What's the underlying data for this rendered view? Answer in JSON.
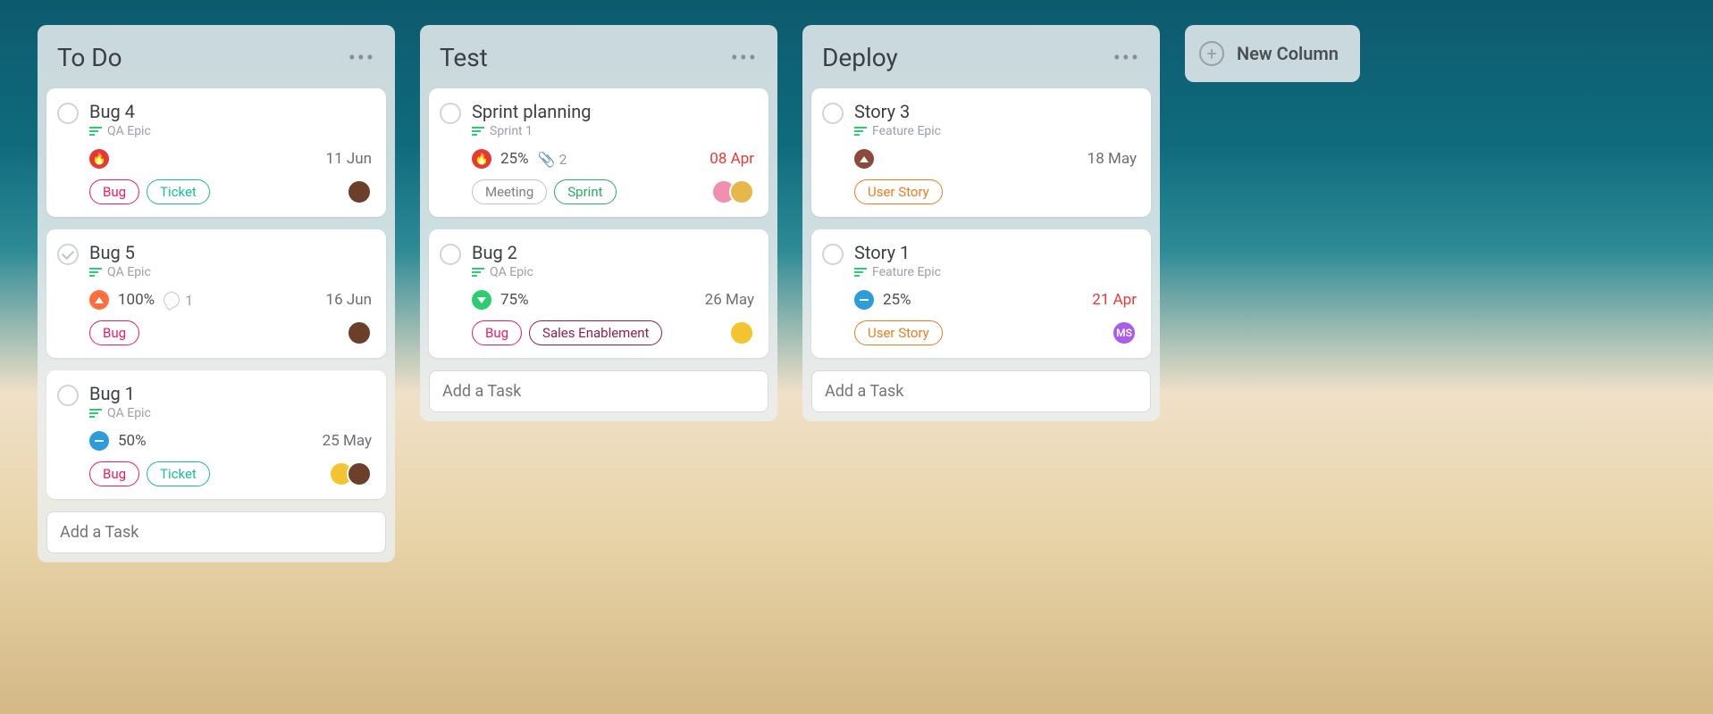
{
  "new_column_label": "New Column",
  "add_task_placeholder": "Add a Task",
  "columns": [
    {
      "title": "To Do",
      "cards": [
        {
          "title": "Bug 4",
          "epic": "QA Epic",
          "priority": "fire",
          "due": "11 Jun",
          "due_red": false,
          "tags": [
            [
              "Bug",
              "bug"
            ],
            [
              "Ticket",
              "ticket"
            ]
          ],
          "avatars": [
            {
              "bg": "#6b3f2a",
              "txt": ""
            }
          ]
        },
        {
          "title": "Bug 5",
          "epic": "QA Epic",
          "done": true,
          "priority": "up",
          "percent": "100%",
          "comments": "1",
          "due": "16 Jun",
          "due_red": false,
          "tags": [
            [
              "Bug",
              "bug"
            ]
          ],
          "avatars": [
            {
              "bg": "#6b3f2a",
              "txt": ""
            }
          ]
        },
        {
          "title": "Bug 1",
          "epic": "QA Epic",
          "priority": "medium",
          "percent": "50%",
          "due": "25 May",
          "due_red": false,
          "tags": [
            [
              "Bug",
              "bug"
            ],
            [
              "Ticket",
              "ticket"
            ]
          ],
          "avatars": [
            {
              "bg": "#f4c430",
              "txt": ""
            },
            {
              "bg": "#6b3f2a",
              "txt": ""
            }
          ]
        }
      ]
    },
    {
      "title": "Test",
      "cards": [
        {
          "title": "Sprint planning",
          "epic": "Sprint 1",
          "priority": "fire",
          "percent": "25%",
          "attachments": "2",
          "due": "08 Apr",
          "due_red": true,
          "tags": [
            [
              "Meeting",
              "meeting"
            ],
            [
              "Sprint",
              "sprint"
            ]
          ],
          "avatars": [
            {
              "bg": "#f08fb0",
              "txt": ""
            },
            {
              "bg": "#e6b84a",
              "txt": ""
            }
          ]
        },
        {
          "title": "Bug 2",
          "epic": "QA Epic",
          "priority": "down",
          "percent": "75%",
          "due": "26 May",
          "due_red": false,
          "tags": [
            [
              "Bug",
              "bug"
            ],
            [
              "Sales Enablement",
              "sales"
            ]
          ],
          "avatars": [
            {
              "bg": "#f4c430",
              "txt": ""
            }
          ]
        }
      ]
    },
    {
      "title": "Deploy",
      "cards": [
        {
          "title": "Story 3",
          "epic": "Feature Epic",
          "priority": "dark",
          "due": "18 May",
          "due_red": false,
          "tags": [
            [
              "User Story",
              "story"
            ]
          ],
          "avatars": []
        },
        {
          "title": "Story 1",
          "epic": "Feature Epic",
          "priority": "medium",
          "percent": "25%",
          "due": "21 Apr",
          "due_red": true,
          "tags": [
            [
              "User Story",
              "story"
            ]
          ],
          "avatars": [
            {
              "bg": "#a85ee6",
              "txt": "MS"
            }
          ]
        }
      ]
    }
  ]
}
